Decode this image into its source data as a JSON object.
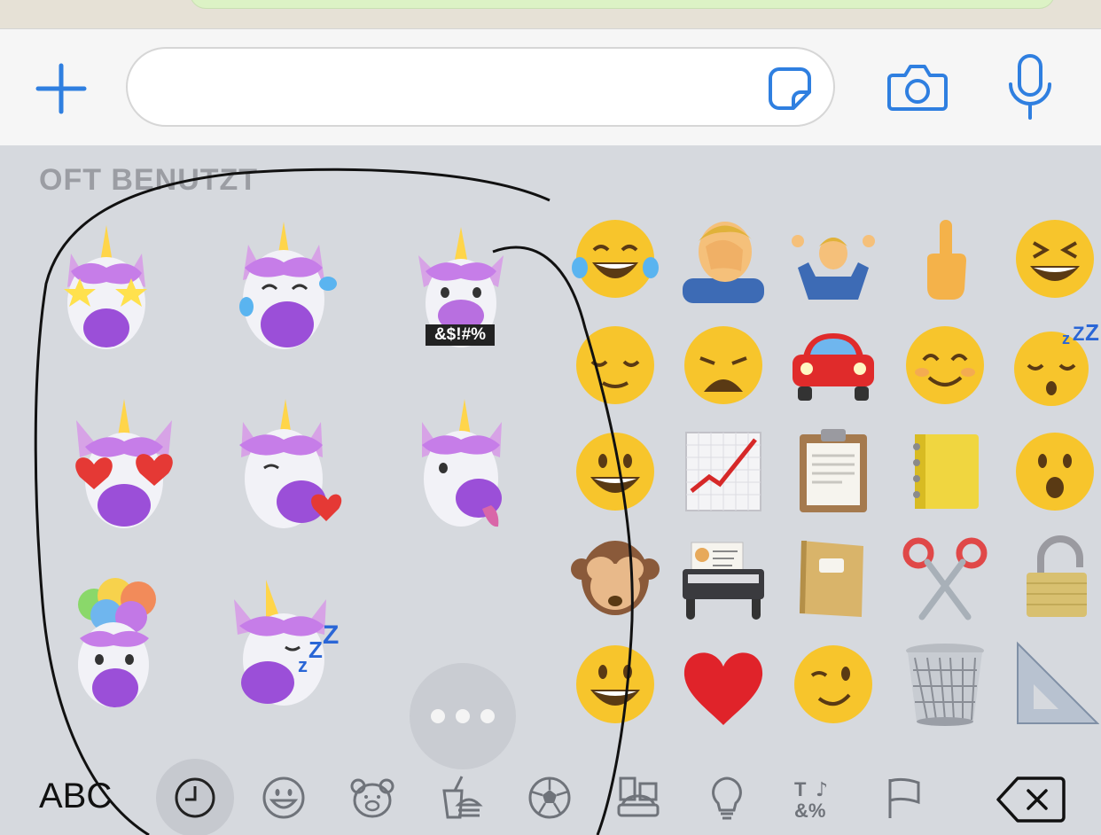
{
  "input_bar": {
    "plus_icon": "plus-icon",
    "message_placeholder": "",
    "sticker_icon": "sticker-icon",
    "camera_icon": "camera-icon",
    "mic_icon": "microphone-icon",
    "accent_color": "#2f7fe0"
  },
  "keyboard": {
    "section_title": "OFT BENUTZT",
    "stickers": [
      {
        "name": "unicorn-star-eyes"
      },
      {
        "name": "unicorn-laughing-tears"
      },
      {
        "name": "unicorn-swearing",
        "caption": "&$!#%"
      },
      {
        "name": "unicorn-heart-eyes"
      },
      {
        "name": "unicorn-wink-heart"
      },
      {
        "name": "unicorn-tongue-out"
      },
      {
        "name": "unicorn-mind-blown"
      },
      {
        "name": "unicorn-sleeping"
      }
    ],
    "more_label": "more-icon",
    "emojis": [
      "face-with-tears-of-joy",
      "man-facepalming",
      "man-shrugging",
      "middle-finger",
      "squinting-face",
      "relieved-face",
      "weary-face",
      "automobile",
      "smiling-face-with-smiling-eyes",
      "sleeping-face",
      "grinning-face-with-big-eyes",
      "chart-increasing",
      "clipboard",
      "ledger",
      "face-with-open-mouth",
      "see-no-evil-monkey",
      "card-index",
      "notebook",
      "scissors",
      "unlocked",
      "grinning-face",
      "red-heart",
      "winking-face",
      "wastebasket",
      "triangular-ruler"
    ]
  },
  "category_bar": {
    "abc_label": "ABC",
    "categories": [
      "recent-clock-icon",
      "smileys-icon",
      "animals-icon",
      "food-icon",
      "sports-icon",
      "travel-icon",
      "objects-icon",
      "symbols-icon",
      "flags-icon"
    ],
    "active": "recent-clock-icon",
    "symbols_text_top": "T",
    "symbols_text_bottom": "&%",
    "backspace_icon": "backspace-icon"
  }
}
